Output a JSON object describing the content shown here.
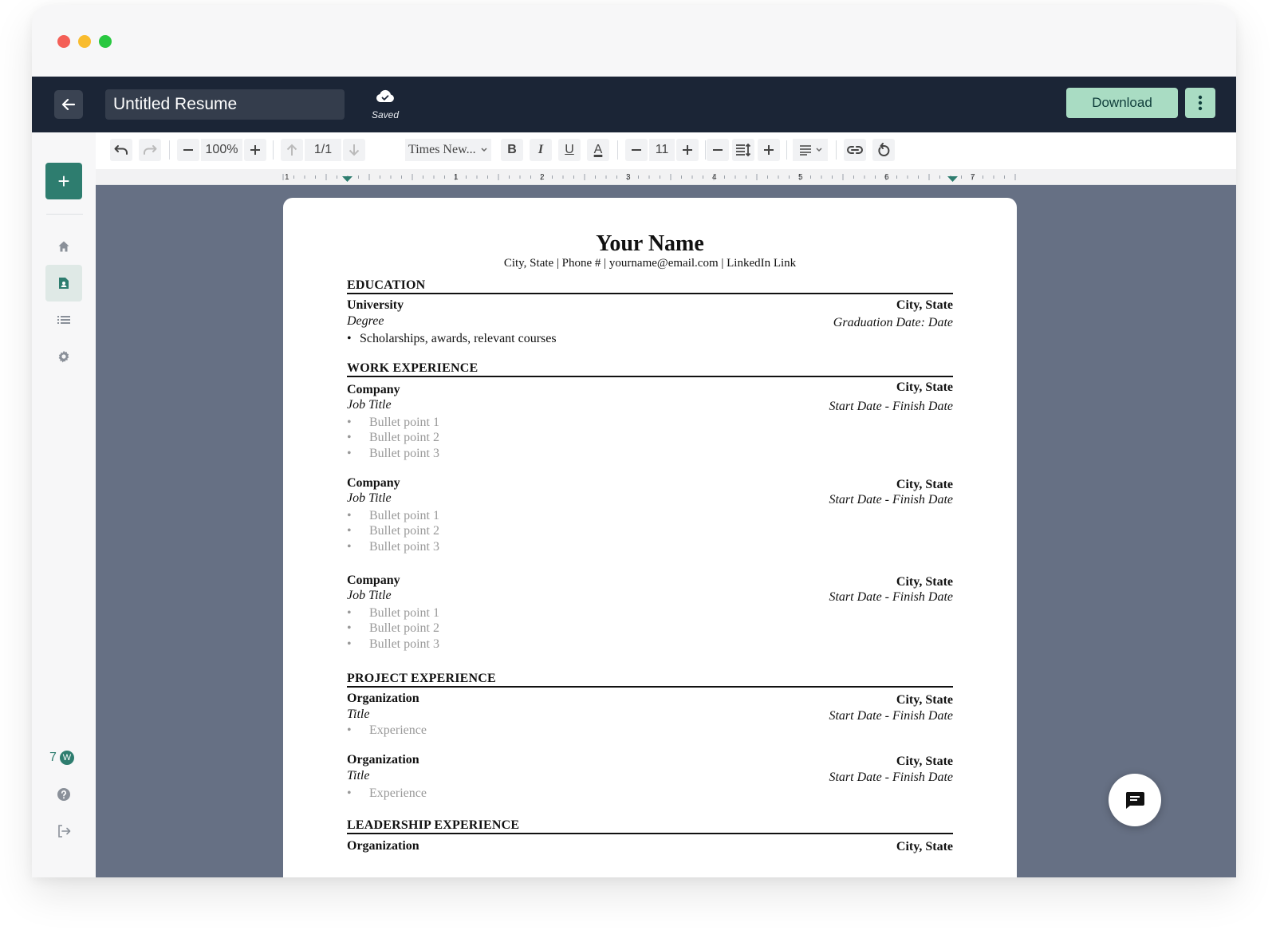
{
  "window": {
    "traffic_colors": [
      "#f45f57",
      "#f9bc2e",
      "#29c840"
    ]
  },
  "header": {
    "document_title": "Untitled Resume",
    "save_status": "Saved",
    "download_label": "Download",
    "icons": [
      "arrow-left-icon",
      "cloud-check-icon",
      "more-vertical-icon"
    ]
  },
  "sidebar": {
    "add_label": "+",
    "items": [
      {
        "name": "home",
        "icon": "home-icon"
      },
      {
        "name": "resume",
        "icon": "resume-doc-icon",
        "active": true
      },
      {
        "name": "list",
        "icon": "list-icon"
      },
      {
        "name": "settings",
        "icon": "gear-icon"
      }
    ],
    "credits_count": "7",
    "credits_badge": "W",
    "bottom_icons": [
      "help-icon",
      "logout-icon"
    ]
  },
  "toolbar": {
    "zoom": "100%",
    "page_indicator": "1/1",
    "font_name": "Times New...",
    "font_size": "11",
    "bold": "B",
    "italic": "I",
    "underline": "U",
    "color": "A"
  },
  "ruler": {
    "labels": [
      "1",
      "1",
      "2",
      "3",
      "4",
      "5",
      "6",
      "7"
    ]
  },
  "resume": {
    "name": "Your Name",
    "contact": "City, State | Phone # | yourname@email.com | LinkedIn Link",
    "sections": {
      "education": {
        "title": "EDUCATION",
        "entry": {
          "org": "University",
          "location": "City, State",
          "role": "Degree",
          "date": "Graduation Date: Date",
          "bullet": "Scholarships, awards, relevant courses"
        }
      },
      "work": {
        "title": "WORK EXPERIENCE",
        "entries": [
          {
            "org": "Company",
            "location": "City, State",
            "role": "Job Title",
            "date": "Start Date - Finish Date",
            "bullets": [
              "Bullet point 1",
              "Bullet point 2",
              "Bullet point 3"
            ]
          },
          {
            "org": "Company",
            "location": "City, State",
            "role": "Job Title",
            "date": "Start Date - Finish Date",
            "bullets": [
              "Bullet point 1",
              "Bullet point 2",
              "Bullet point 3"
            ]
          },
          {
            "org": "Company",
            "location": "City, State",
            "role": "Job Title",
            "date": "Start Date - Finish Date",
            "bullets": [
              "Bullet point 1",
              "Bullet point 2",
              "Bullet point 3"
            ]
          }
        ]
      },
      "project": {
        "title": "PROJECT EXPERIENCE",
        "entries": [
          {
            "org": "Organization",
            "location": "City, State",
            "role": "Title",
            "date": "Start Date - Finish Date",
            "bullet": "Experience"
          },
          {
            "org": "Organization",
            "location": "City, State",
            "role": "Title",
            "date": "Start Date - Finish Date",
            "bullet": "Experience"
          }
        ]
      },
      "leadership": {
        "title": "LEADERSHIP EXPERIENCE",
        "entry": {
          "org": "Organization",
          "location": "City, State"
        }
      }
    }
  },
  "colors": {
    "topbar": "#1b2536",
    "accent": "#2e7d6f",
    "download_bg": "#a9dcc3",
    "canvas": "#667084"
  }
}
